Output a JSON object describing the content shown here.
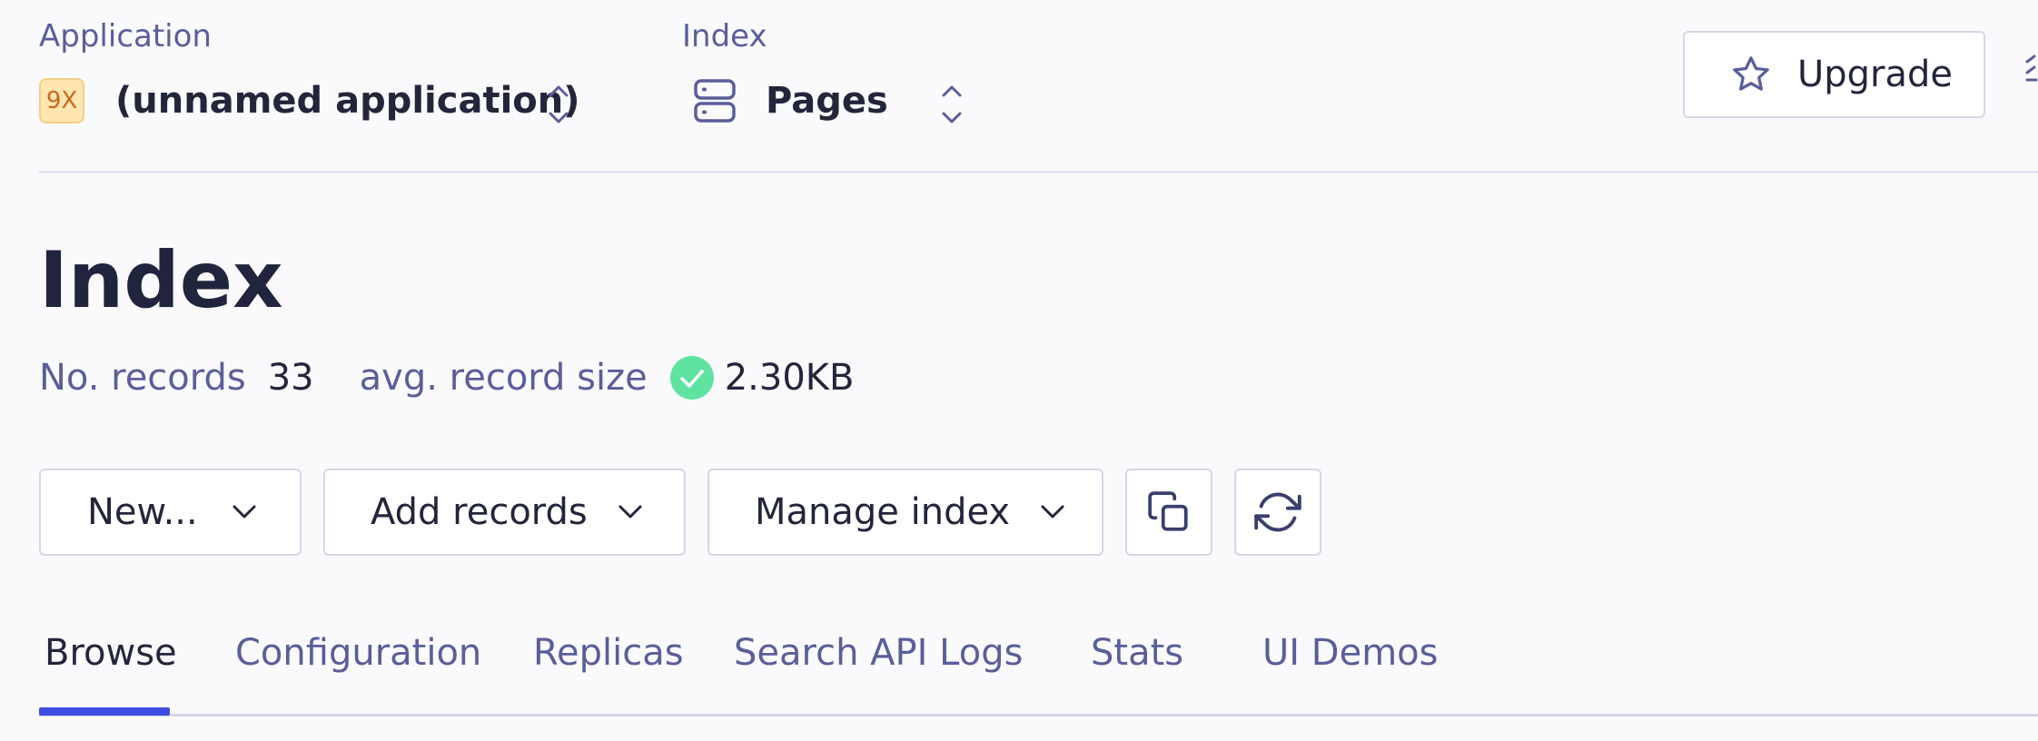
{
  "header": {
    "application": {
      "label": "Application",
      "badge": "9X",
      "name": "(unnamed application)"
    },
    "index": {
      "label": "Index",
      "name": "Pages"
    },
    "upgrade_label": "Upgrade"
  },
  "page": {
    "title": "Index",
    "stats": {
      "records_label": "No. records",
      "records_value": "33",
      "size_label": "avg. record size",
      "size_value": "2.30KB"
    }
  },
  "toolbar": {
    "new_label": "New...",
    "add_records_label": "Add records",
    "manage_index_label": "Manage index"
  },
  "tabs": [
    {
      "label": "Browse"
    },
    {
      "label": "Configuration"
    },
    {
      "label": "Replicas"
    },
    {
      "label": "Search API Logs"
    },
    {
      "label": "Stats"
    },
    {
      "label": "UI Demos"
    }
  ],
  "colors": {
    "accent": "#3c4fe0",
    "success": "#5ee3a1",
    "muted_text": "#5a5e9a"
  },
  "icons": [
    "chevrons-up-down-icon",
    "server-icon",
    "star-icon",
    "check-circle-icon",
    "chevron-down-icon",
    "copy-icon",
    "refresh-icon"
  ]
}
